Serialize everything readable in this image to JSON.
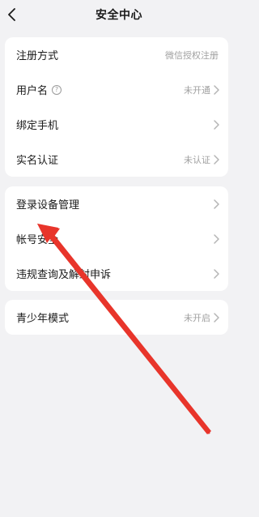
{
  "header": {
    "title": "安全中心"
  },
  "group1": {
    "items": [
      {
        "label": "注册方式",
        "value": "微信授权注册"
      },
      {
        "label": "用户名",
        "value": "未开通",
        "help": "?"
      },
      {
        "label": "绑定手机",
        "value": ""
      },
      {
        "label": "实名认证",
        "value": "未认证"
      }
    ]
  },
  "group2": {
    "items": [
      {
        "label": "登录设备管理"
      },
      {
        "label": "帐号安全"
      },
      {
        "label": "违规查询及解封申诉"
      }
    ]
  },
  "group3": {
    "items": [
      {
        "label": "青少年模式",
        "value": "未开启"
      }
    ]
  },
  "annotation": {
    "color": "#e8352b"
  }
}
